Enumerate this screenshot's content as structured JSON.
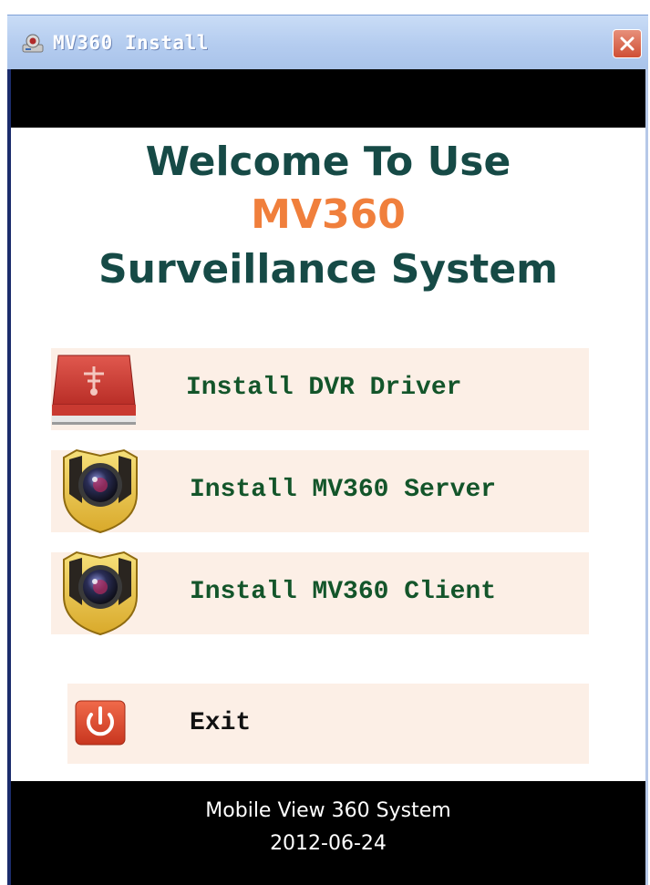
{
  "window": {
    "title": "MV360 Install"
  },
  "welcome": {
    "line1": "Welcome To Use",
    "line2": "MV360",
    "line3": "Surveillance System"
  },
  "menu": {
    "install_dvr": "Install DVR Driver",
    "install_server": "Install MV360 Server",
    "install_client": "Install MV360 Client",
    "exit": "Exit"
  },
  "footer": {
    "line1": "Mobile View 360 System",
    "line2": "2012-06-24"
  },
  "colors": {
    "title_text": "#164a46",
    "accent": "#f07f3c",
    "menu_bg": "#fcefe6",
    "menu_text": "#13552a"
  },
  "icons": {
    "app": "app-icon",
    "close": "close-icon",
    "dvr": "dvr-driver-icon",
    "server": "camera-shield-icon",
    "client": "camera-shield-icon",
    "exit": "power-icon"
  }
}
